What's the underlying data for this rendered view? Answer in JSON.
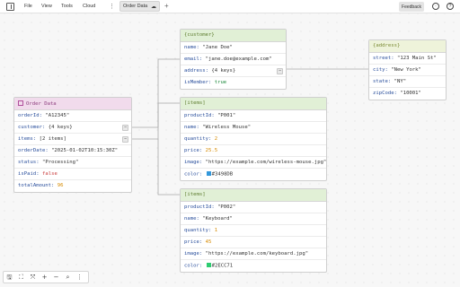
{
  "menu": [
    "File",
    "View",
    "Tools",
    "Cloud"
  ],
  "tab": {
    "label": "Order Data"
  },
  "feedback_label": "Feedback",
  "nodes": {
    "order": {
      "title": "Order Data",
      "rows": [
        {
          "key": "orderId",
          "val": "\"A12345\""
        },
        {
          "key": "customer",
          "val": "{4 keys}"
        },
        {
          "key": "items",
          "val": "[2 items]"
        },
        {
          "key": "orderDate",
          "val": "\"2025-01-02T10:15:30Z\""
        },
        {
          "key": "status",
          "val": "\"Processing\""
        },
        {
          "key": "isPaid",
          "val": "false"
        },
        {
          "key": "totalAmount",
          "val": "96"
        }
      ]
    },
    "customer": {
      "title": "{customer}",
      "rows": [
        {
          "key": "name",
          "val": "\"Jane Doe\""
        },
        {
          "key": "email",
          "val": "\"jane.doe@example.com\""
        },
        {
          "key": "address",
          "val": "{4 keys}"
        },
        {
          "key": "isMember",
          "val": "true"
        }
      ]
    },
    "address": {
      "title": "{address}",
      "rows": [
        {
          "key": "street",
          "val": "\"123 Main St\""
        },
        {
          "key": "city",
          "val": "\"New York\""
        },
        {
          "key": "state",
          "val": "\"NY\""
        },
        {
          "key": "zipCode",
          "val": "\"10001\""
        }
      ]
    },
    "item0": {
      "title": "[items]",
      "rows": [
        {
          "key": "productId",
          "val": "\"P001\""
        },
        {
          "key": "name",
          "val": "\"Wireless Mouse\""
        },
        {
          "key": "quantity",
          "val": "2"
        },
        {
          "key": "price",
          "val": "25.5"
        },
        {
          "key": "image",
          "val": "\"https://example.com/wireless-mouse.jpg\""
        },
        {
          "key": "color",
          "val": "#3498DB"
        }
      ]
    },
    "item1": {
      "title": "[items]",
      "rows": [
        {
          "key": "productId",
          "val": "\"P002\""
        },
        {
          "key": "name",
          "val": "\"Keyboard\""
        },
        {
          "key": "quantity",
          "val": "1"
        },
        {
          "key": "price",
          "val": "45"
        },
        {
          "key": "image",
          "val": "\"https://example.com/keyboard.jpg\""
        },
        {
          "key": "color",
          "val": "#2ECC71"
        }
      ]
    }
  },
  "colors": {
    "order_header": "#f1dbec",
    "object_header": "#e1f0d6",
    "address_header": "#eef3da",
    "key": "#2a4f9c",
    "number": "#d68a00",
    "true": "#1e8a3c",
    "false": "#c93a3a",
    "item0_swatch": "#3498DB",
    "item1_swatch": "#2ECC71"
  },
  "toolbar_icons": [
    "save-icon",
    "fit-icon",
    "expand-icon",
    "zoom-in-icon",
    "zoom-out-icon",
    "search-icon",
    "more-icon"
  ]
}
